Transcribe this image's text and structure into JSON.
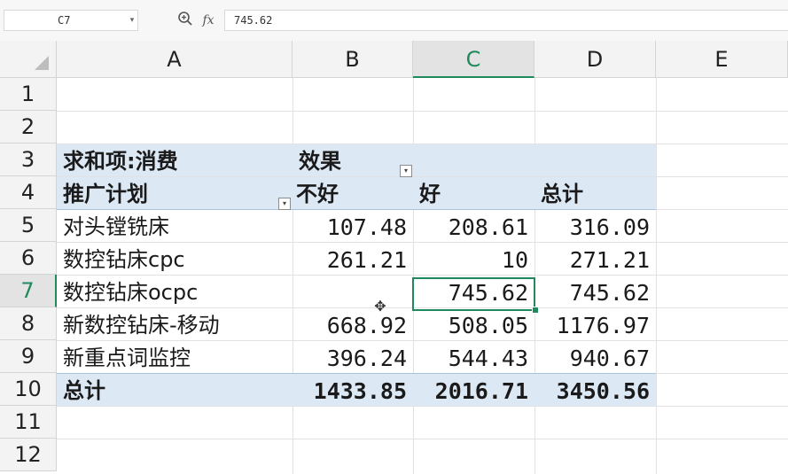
{
  "formula_bar": {
    "name_box": "C7",
    "zoom_icon": "zoom-in-icon",
    "fx_label": "fx",
    "formula": "745.62"
  },
  "columns": [
    "A",
    "B",
    "C",
    "D",
    "E"
  ],
  "rows": [
    "1",
    "2",
    "3",
    "4",
    "5",
    "6",
    "7",
    "8",
    "9",
    "10",
    "11",
    "12"
  ],
  "active_cell": {
    "column": "C",
    "row": "7"
  },
  "pivot": {
    "header_row": {
      "value_label": "求和项:消费",
      "col_field": "效果"
    },
    "field_row": {
      "row_field": "推广计划",
      "c1": "不好",
      "c2": "好",
      "total": "总计"
    },
    "data": [
      {
        "label": "对头镗铣床",
        "b": "107.48",
        "c": "208.61",
        "d": "316.09"
      },
      {
        "label": "数控钻床cpc",
        "b": "261.21",
        "c": "10",
        "d": "271.21"
      },
      {
        "label": "数控钻床ocpc",
        "b": "",
        "c": "745.62",
        "d": "745.62"
      },
      {
        "label": "新数控钻床-移动",
        "b": "668.92",
        "c": "508.05",
        "d": "1176.97"
      },
      {
        "label": "新重点词监控",
        "b": "396.24",
        "c": "544.43",
        "d": "940.67"
      }
    ],
    "total_row": {
      "label": "总计",
      "b": "1433.85",
      "c": "2016.71",
      "d": "3450.56"
    }
  },
  "colors": {
    "accent": "#1f8a5b",
    "pivot_band": "#dde8f5"
  }
}
